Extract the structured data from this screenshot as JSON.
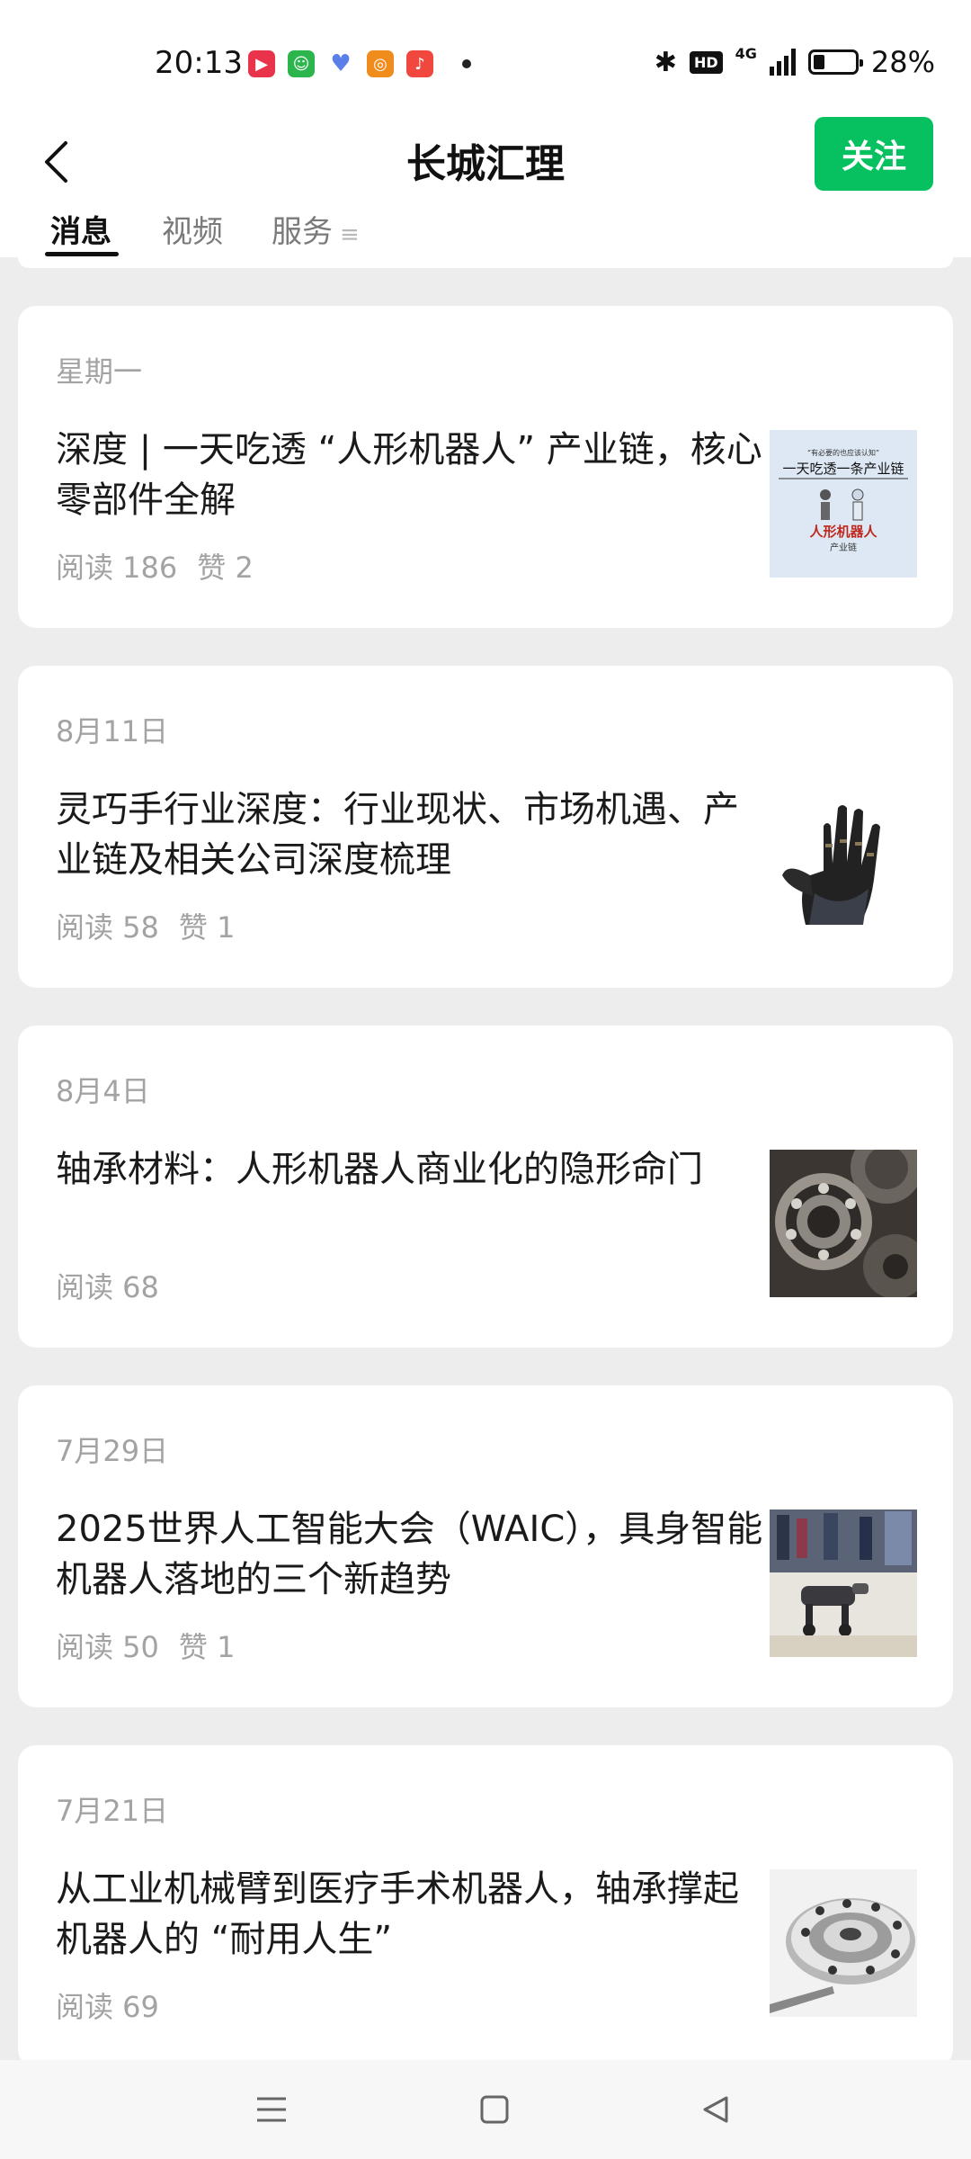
{
  "status_bar": {
    "time": "20:13",
    "battery": "28%",
    "battery_level": 0.28,
    "network": "4G",
    "hd": "HD"
  },
  "header": {
    "title": "长城汇理",
    "follow_label": "关注"
  },
  "tabs": [
    {
      "label": "消息",
      "active": true
    },
    {
      "label": "视频",
      "active": false
    },
    {
      "label": "服务",
      "active": false
    }
  ],
  "articles": [
    {
      "date": "星期一",
      "title": "深度 | 一天吃透 “人形机器人” 产业链，核心零部件全解",
      "reads": "阅读 186",
      "likes": "赞 2",
      "thumb_icon": "humanoid-robot-chain-thumb",
      "thumb_lines": [
        "“有必要的也应该认知”",
        "一天吃透一条产业链",
        "人形机器人",
        "产业链"
      ]
    },
    {
      "date": "8月11日",
      "title": "灵巧手行业深度：行业现状、市场机遇、产业链及相关公司深度梳理",
      "reads": "阅读 58",
      "likes": "赞 1",
      "thumb_icon": "robot-hand-thumb"
    },
    {
      "date": "8月4日",
      "title": "轴承材料：人形机器人商业化的隐形命门",
      "reads": "阅读 68",
      "likes": "",
      "thumb_icon": "bearings-gears-thumb"
    },
    {
      "date": "7月29日",
      "title": "2025世界人工智能大会（WAIC），具身智能机器人落地的三个新趋势",
      "reads": "阅读 50",
      "likes": "赞 1",
      "thumb_icon": "robot-dog-exhibition-thumb"
    },
    {
      "date": "7月21日",
      "title": "从工业机械臂到医疗手术机器人，轴承撑起机器人的 “耐用人生”",
      "reads": "阅读 69",
      "likes": "",
      "thumb_icon": "precision-bearing-thumb"
    }
  ],
  "nav": {
    "menu_icon": "menu-icon",
    "home_icon": "home-square-icon",
    "back_icon": "back-triangle-icon"
  },
  "colors": {
    "accent": "#07c160",
    "background": "#ededed",
    "muted_text": "#a3a3a3"
  }
}
